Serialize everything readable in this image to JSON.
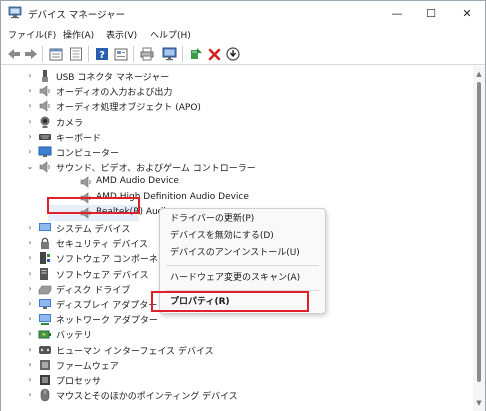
{
  "window": {
    "title": "デバイス マネージャー",
    "minimize_glyph": "—",
    "maximize_glyph": "☐",
    "close_glyph": "✕"
  },
  "menubar": {
    "items": [
      "ファイル(F)",
      "操作(A)",
      "表示(V)",
      "ヘルプ(H)"
    ]
  },
  "toolbar": {
    "buttons": [
      "back-arrow-icon",
      "forward-arrow-icon",
      "show-hide-tree-icon",
      "properties-icon",
      "help-icon",
      "view-icon",
      "print-icon",
      "monitor-icon",
      "add-driver-icon",
      "uninstall-icon",
      "update-icon"
    ],
    "accent_red": "#d32020",
    "accent_green": "#2e8b3a",
    "accent_blue": "#2a5db0"
  },
  "tree": {
    "rows": [
      {
        "label": "USB コネクタ マネージャー",
        "expanded": false,
        "level": 1,
        "icon": "usb-connector-icon"
      },
      {
        "label": "オーディオの入力および出力",
        "expanded": false,
        "level": 1,
        "icon": "speaker-icon"
      },
      {
        "label": "オーディオ処理オブジェクト (APO)",
        "expanded": false,
        "level": 1,
        "icon": "speaker-icon"
      },
      {
        "label": "カメラ",
        "expanded": false,
        "level": 1,
        "icon": "camera-icon"
      },
      {
        "label": "キーボード",
        "expanded": false,
        "level": 1,
        "icon": "keyboard-icon"
      },
      {
        "label": "コンピューター",
        "expanded": false,
        "level": 1,
        "icon": "computer-icon"
      },
      {
        "label": "サウンド、ビデオ、およびゲーム コントローラー",
        "expanded": true,
        "level": 1,
        "icon": "speaker-icon"
      },
      {
        "label": "AMD Audio Device",
        "level": 2,
        "icon": "speaker-icon"
      },
      {
        "label": "AMD High Definition Audio Device",
        "level": 2,
        "icon": "speaker-icon"
      },
      {
        "label": "Realtek(R) Audio",
        "level": 2,
        "icon": "speaker-icon",
        "selected": true
      },
      {
        "label": "システム デバイス",
        "expanded": false,
        "level": 1,
        "icon": "system-device-icon"
      },
      {
        "label": "セキュリティ デバイス",
        "expanded": false,
        "level": 1,
        "icon": "security-device-icon"
      },
      {
        "label": "ソフトウェア コンポーネン",
        "expanded": false,
        "level": 1,
        "icon": "software-component-icon"
      },
      {
        "label": "ソフトウェア デバイス",
        "expanded": false,
        "level": 1,
        "icon": "software-device-icon"
      },
      {
        "label": "ディスク ドライブ",
        "expanded": false,
        "level": 1,
        "icon": "disk-drive-icon"
      },
      {
        "label": "ディスプレイ アダプター",
        "expanded": false,
        "level": 1,
        "icon": "display-adapter-icon"
      },
      {
        "label": "ネットワーク アダプター",
        "expanded": false,
        "level": 1,
        "icon": "network-adapter-icon"
      },
      {
        "label": "バッテリ",
        "expanded": false,
        "level": 1,
        "icon": "battery-icon"
      },
      {
        "label": "ヒューマン インターフェイス デバイス",
        "expanded": false,
        "level": 1,
        "icon": "hid-icon"
      },
      {
        "label": "ファームウェア",
        "expanded": false,
        "level": 1,
        "icon": "firmware-icon"
      },
      {
        "label": "プロセッサ",
        "expanded": false,
        "level": 1,
        "icon": "processor-icon"
      },
      {
        "label": "マウスとそのほかのポインティング デバイス",
        "expanded": false,
        "level": 1,
        "icon": "mouse-icon"
      }
    ]
  },
  "context_menu": {
    "items": [
      "ドライバーの更新(P)",
      "デバイスを無効にする(D)",
      "デバイスのアンインストール(U)",
      "ハードウェア変更のスキャン(A)",
      "プロパティ(R)"
    ]
  },
  "highlight_color": "#e0202a"
}
